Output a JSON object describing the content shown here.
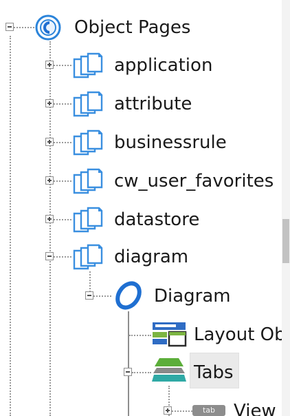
{
  "tree": {
    "root": {
      "label": "Object Pages",
      "icon": "object-pages-icon"
    },
    "children": [
      {
        "label": "application",
        "icon": "pages-stack-icon",
        "expanded": false
      },
      {
        "label": "attribute",
        "icon": "pages-stack-icon",
        "expanded": false
      },
      {
        "label": "businessrule",
        "icon": "pages-stack-icon",
        "expanded": false
      },
      {
        "label": "cw_user_favorites",
        "icon": "pages-stack-icon",
        "expanded": false
      },
      {
        "label": "datastore",
        "icon": "pages-stack-icon",
        "expanded": false
      },
      {
        "label": "diagram",
        "icon": "pages-stack-icon",
        "expanded": true
      }
    ],
    "diagram_children": [
      {
        "label": "Diagram",
        "icon": "diagram-ring-icon",
        "expanded": true
      }
    ],
    "diagram_node_children": [
      {
        "label": "Layout Ob",
        "icon": "layout-object-icon"
      },
      {
        "label": "Tabs",
        "icon": "tabs-stack-icon",
        "expanded": true,
        "selected": true
      }
    ],
    "tabs_children": [
      {
        "label": "View",
        "icon": "tab-chip-icon",
        "icon_text": "tab"
      }
    ]
  },
  "colors": {
    "accent_blue": "#1f6fd1",
    "page_blue": "#3a8fe0",
    "layout_blue": "#2f6cc4",
    "layout_green": "#7cb542",
    "tabs_green": "#5cae3a",
    "tabs_teal": "#2fa9a5",
    "selection": "#eaeaea"
  }
}
